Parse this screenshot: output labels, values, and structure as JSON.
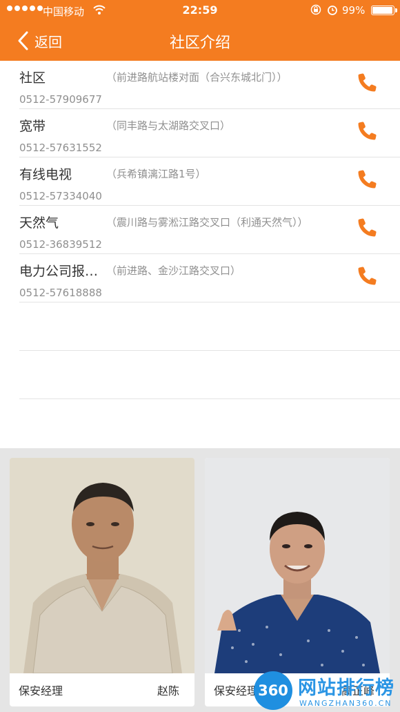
{
  "status_bar": {
    "carrier": "中国移动",
    "time": "22:59",
    "battery": "99%",
    "battery_level": 0.99
  },
  "nav": {
    "back_label": "返回",
    "title": "社区介绍"
  },
  "contacts": [
    {
      "name": "社区",
      "address": "（前进路航站楼对面（合兴东城北门））",
      "phone": "0512-57909677"
    },
    {
      "name": "宽带",
      "address": "（同丰路与太湖路交叉口）",
      "phone": "0512-57631552"
    },
    {
      "name": "有线电视",
      "address": "（兵希镇漓江路1号）",
      "phone": "0512-57334040"
    },
    {
      "name": "天然气",
      "address": "（震川路与雾淞江路交叉口（利通天然气））",
      "phone": "0512-36839512"
    },
    {
      "name": "电力公司报…",
      "address": "（前进路、金沙江路交叉口）",
      "phone": "0512-57618888"
    }
  ],
  "staff": [
    {
      "role": "保安经理",
      "name": "赵陈"
    },
    {
      "role": "保安经理",
      "name": "高正峰"
    }
  ],
  "watermark": {
    "badge": "360",
    "text": "网站排行榜",
    "sub": "WANGZHAN360.CN"
  },
  "colors": {
    "accent": "#f47c20",
    "text": "#333333",
    "muted": "#8f8f8f"
  },
  "icons": {
    "back": "chevron-left-icon",
    "call": "phone-icon"
  }
}
